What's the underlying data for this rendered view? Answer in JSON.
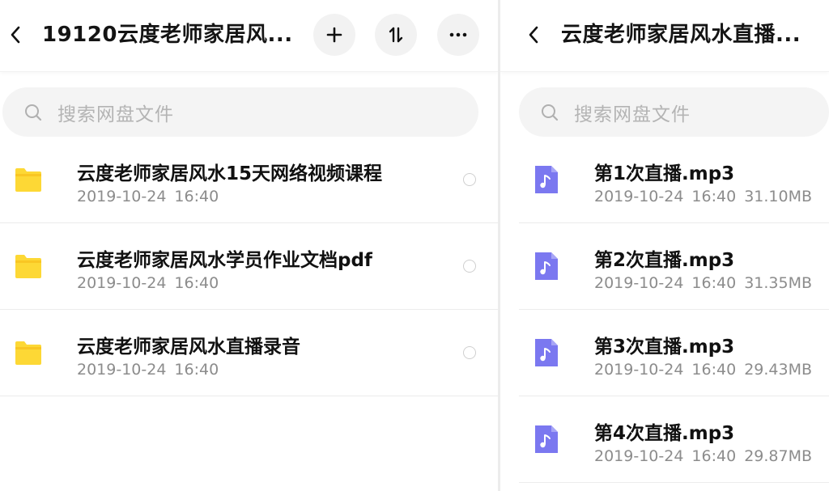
{
  "left": {
    "title": "19120云度老师家居风...",
    "back_icon": "chevron-left-icon",
    "actions": [
      "plus-icon",
      "sort-icon",
      "more-icon"
    ],
    "search_placeholder": "搜索网盘文件",
    "items": [
      {
        "name": "云度老师家居风水15天网络视频课程",
        "date": "2019-10-24",
        "time": "16:40",
        "icon": "folder-icon"
      },
      {
        "name": "云度老师家居风水学员作业文档pdf",
        "date": "2019-10-24",
        "time": "16:40",
        "icon": "folder-icon"
      },
      {
        "name": "云度老师家居风水直播录音",
        "date": "2019-10-24",
        "time": "16:40",
        "icon": "folder-icon"
      }
    ]
  },
  "right": {
    "title": "云度老师家居风水直播...",
    "back_icon": "chevron-left-icon",
    "search_placeholder": "搜索网盘文件",
    "items": [
      {
        "name": "第1次直播.mp3",
        "date": "2019-10-24",
        "time": "16:40",
        "size": "31.10MB",
        "icon": "audio-file-icon"
      },
      {
        "name": "第2次直播.mp3",
        "date": "2019-10-24",
        "time": "16:40",
        "size": "31.35MB",
        "icon": "audio-file-icon"
      },
      {
        "name": "第3次直播.mp3",
        "date": "2019-10-24",
        "time": "16:40",
        "size": "29.43MB",
        "icon": "audio-file-icon"
      },
      {
        "name": "第4次直播.mp3",
        "date": "2019-10-24",
        "time": "16:40",
        "size": "29.87MB",
        "icon": "audio-file-icon"
      }
    ]
  },
  "colors": {
    "folder": "#FDD835",
    "audio_icon": "#7B78F0",
    "meta_text": "#8C8C8C",
    "search_bg": "#F4F4F4"
  }
}
